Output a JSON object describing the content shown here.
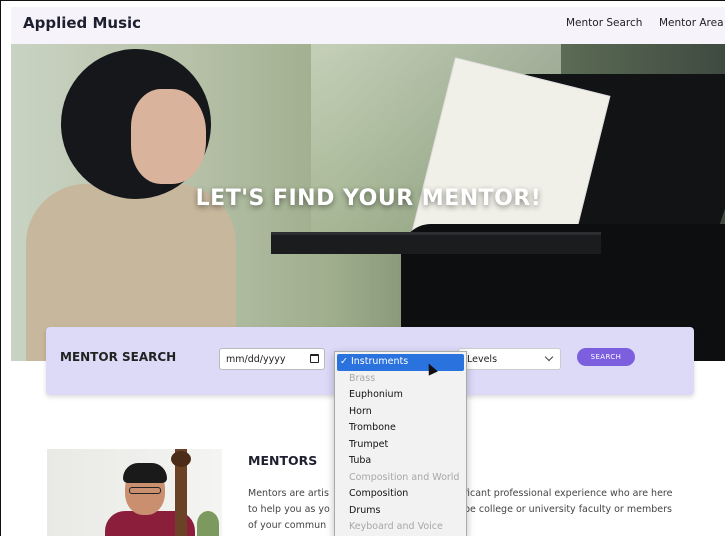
{
  "navbar": {
    "brand": "Applied Music",
    "links": [
      "Mentor Search",
      "Mentor Area"
    ]
  },
  "hero": {
    "title": "LET'S FIND YOUR MENTOR!"
  },
  "search": {
    "title": "MENTOR SEARCH",
    "date_placeholder": "mm/dd/yyyy",
    "levels_value": "Levels",
    "button_label": "SEARCH"
  },
  "dropdown": {
    "items": [
      {
        "label": "✓ Instruments",
        "state": "selected"
      },
      {
        "label": "Brass",
        "state": "disabled"
      },
      {
        "label": "Euphonium",
        "state": "enabled"
      },
      {
        "label": "Horn",
        "state": "enabled"
      },
      {
        "label": "Trombone",
        "state": "enabled"
      },
      {
        "label": "Trumpet",
        "state": "enabled"
      },
      {
        "label": "Tuba",
        "state": "enabled"
      },
      {
        "label": "Composition and World",
        "state": "disabled"
      },
      {
        "label": "Composition",
        "state": "enabled"
      },
      {
        "label": "Drums",
        "state": "enabled"
      },
      {
        "label": "Keyboard and Voice",
        "state": "disabled"
      }
    ]
  },
  "mentors": {
    "heading": "MENTORS",
    "left_lines": [
      "Mentors are artis",
      "to help you as yo",
      "of your commun"
    ],
    "right_lines": [
      "ficant professional experience who are here",
      "be college or university faculty or members"
    ]
  },
  "colors": {
    "accent": "#7b5fdf",
    "panel": "#dcdaf7",
    "navbar": "#f6f3fb",
    "selected_option": "#2a72de"
  }
}
